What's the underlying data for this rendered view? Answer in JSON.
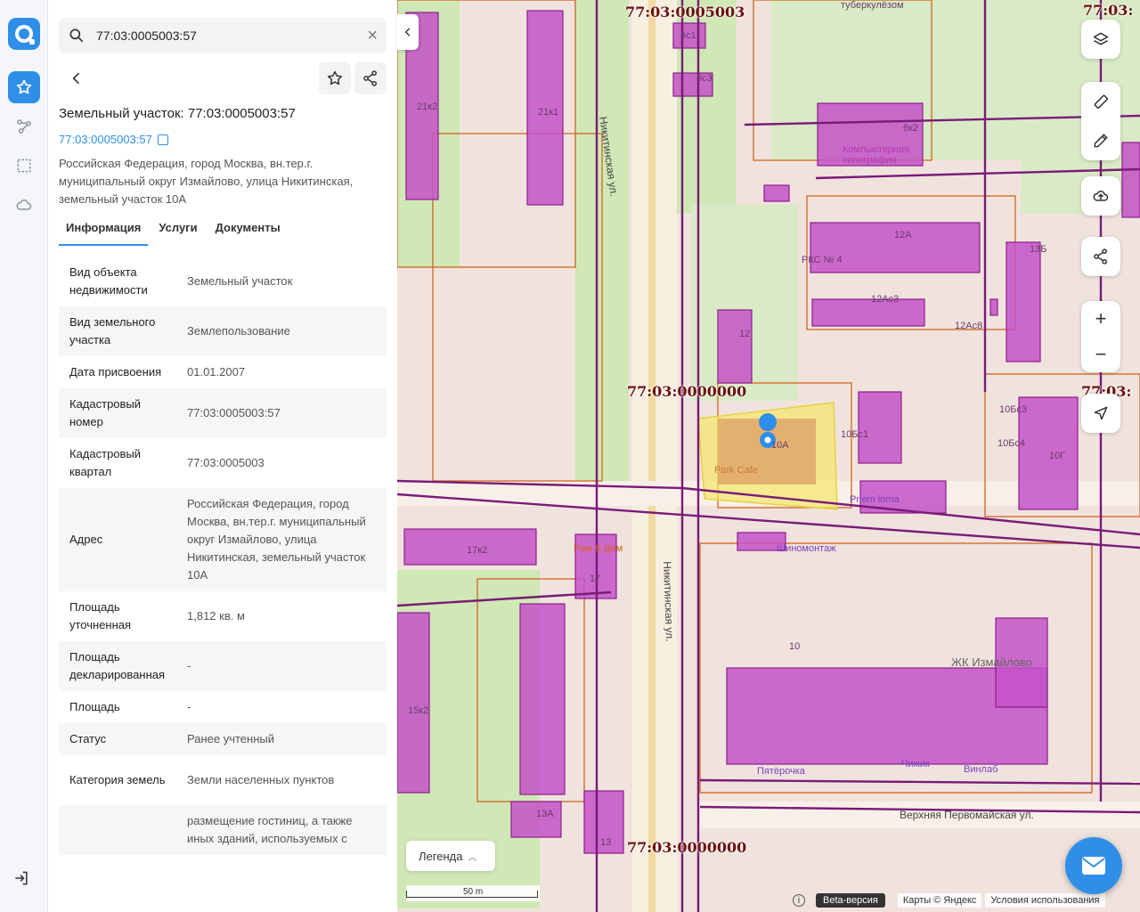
{
  "search": {
    "value": "77:03:0005003:57"
  },
  "panel": {
    "title": "Земельный участок: 77:03:0005003:57",
    "cad_link": "77:03:0005003:57",
    "address": "Российская Федерация, город Москва, вн.тер.г. муниципальный округ Измайлово, улица Никитинская, земельный участок 10А",
    "tabs": [
      "Информация",
      "Услуги",
      "Документы"
    ],
    "rows": [
      {
        "k": "Вид объекта недвижимости",
        "v": "Земельный участок"
      },
      {
        "k": "Вид земельного участка",
        "v": "Землепользование"
      },
      {
        "k": "Дата присвоения",
        "v": "01.01.2007"
      },
      {
        "k": "Кадастровый номер",
        "v": "77:03:0005003:57"
      },
      {
        "k": "Кадастровый квартал",
        "v": "77:03:0005003"
      },
      {
        "k": "Адрес",
        "v": "Российская Федерация, город Москва, вн.тер.г. муниципальный округ Измайлово, улица Никитинская, земельный участок 10А"
      },
      {
        "k": "Площадь уточненная",
        "v": "1,812 кв. м"
      },
      {
        "k": "Площадь декларированная",
        "v": "-"
      },
      {
        "k": "Площадь",
        "v": "-"
      },
      {
        "k": "Статус",
        "v": "Ранее учтенный"
      },
      {
        "k": "Категория земель",
        "v": "Земли населенных пунктов"
      },
      {
        "k": "",
        "v": "размещение гостиниц, а также иных зданий, используемых с"
      }
    ]
  },
  "map": {
    "cad_labels": [
      "77:03:0005003",
      "77:03:0000000",
      "77:03:0000000",
      "77:03:",
      "77:03:"
    ],
    "street_labels": [
      "Никитинская ул.",
      "Никитинская ул.",
      "Верхняя Первомайская ул.",
      "туберкулёзом"
    ],
    "building_labels": [
      "21к2",
      "21к1",
      "6с1",
      "6с3",
      "6к2",
      "Компьютерная типография",
      "12А",
      "РКС № 4",
      "13Б",
      "12Ас3",
      "12Ас8",
      "12",
      "10Бс3",
      "10Бс1",
      "10Бс4",
      "10Г",
      "10А",
      "Park Cafe",
      "Priem loma",
      "Шиномонтаж",
      "Ром & Дом",
      "17к2",
      "17",
      "10",
      "ЖК Измайлово",
      "15к2",
      "Пятёрочка",
      "Чижик",
      "Винлаб",
      "13А",
      "13"
    ],
    "legend": "Легенда",
    "scale": "50 m",
    "beta": "Beta-версия",
    "copyright": "Карты © Яндекс",
    "terms": "Условия использования"
  },
  "colors": {
    "accent": "#2f8fe8",
    "parcel_border": "#d0651e",
    "building": "#c452c8",
    "cad_boundary": "#7a1a78",
    "selected": "#f5e66a"
  }
}
